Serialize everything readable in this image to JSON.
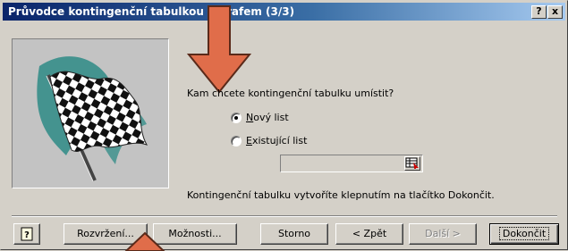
{
  "window": {
    "title": "Průvodce kontingenční tabulkou a grafem (3/3)",
    "help_label": "?",
    "close_label": "x"
  },
  "main": {
    "question": "Kam chcete kontingenční tabulku umístit?",
    "options": [
      {
        "label": "Nový list",
        "accelerator": "N",
        "selected": true
      },
      {
        "label": "Existující list",
        "accelerator": "E",
        "selected": false
      }
    ],
    "location_field": {
      "value": ""
    },
    "hint": "Kontingenční tabulku vytvoříte klepnutím na tlačítko Dokončit."
  },
  "buttons": {
    "layout": "Rozvržení...",
    "options": "Možnosti...",
    "cancel": "Storno",
    "back": "< Zpět",
    "next": "Další >",
    "finish": "Dokončit",
    "help": "?"
  },
  "colors": {
    "titlebar_start": "#0a246a",
    "titlebar_end": "#a6caf0",
    "annotation_arrow": "#e06d4a",
    "dialog_bg": "#d4d0c8"
  },
  "icons": [
    "checkered-flag-illustration",
    "help-icon",
    "close-icon",
    "range-picker-icon",
    "down-arrow-annotation-icon",
    "up-arrow-annotation-icon"
  ]
}
